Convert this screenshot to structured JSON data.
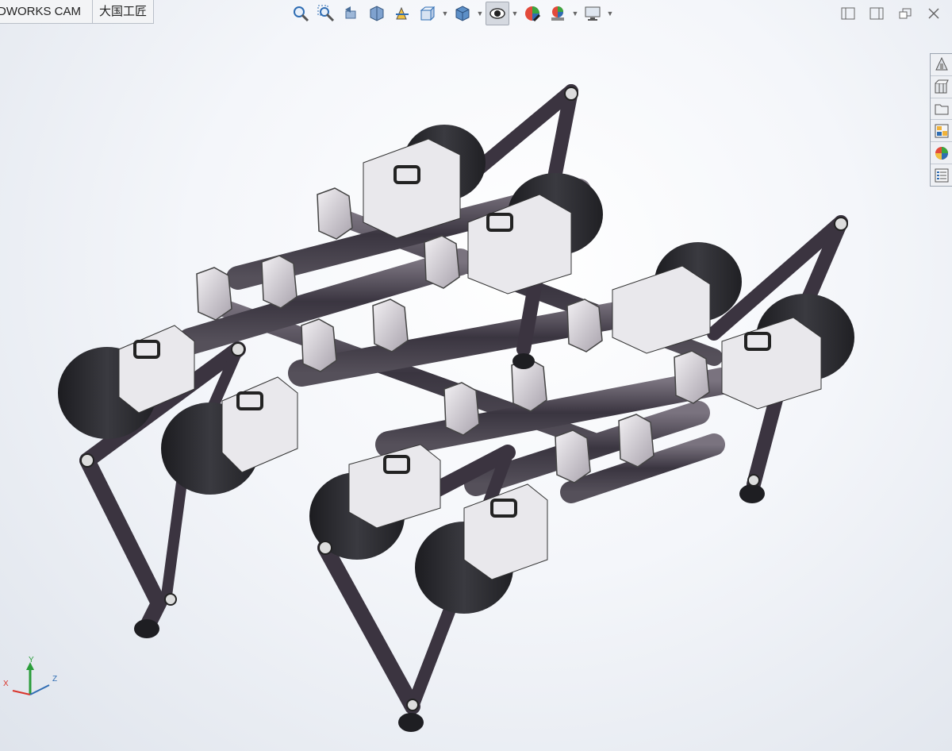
{
  "tabs": [
    {
      "label": "DWORKS CAM"
    },
    {
      "label": "大国工匠"
    }
  ],
  "view_toolbar": {
    "tools": [
      "zoom-to-fit-icon",
      "zoom-to-area-icon",
      "previous-view-icon",
      "section-view-icon",
      "dynamic-annotation-view-icon",
      "view-orientation-icon",
      "display-style-icon",
      "hide-show-items-icon",
      "edit-appearance-icon",
      "apply-scene-icon",
      "view-settings-icon"
    ],
    "active_tool": "hide-show-items-icon"
  },
  "window_controls": [
    "tile-left-icon",
    "tile-right-icon",
    "restore-icon",
    "close-icon"
  ],
  "task_pane": [
    "solidworks-resources-icon",
    "design-library-icon",
    "file-explorer-icon",
    "view-palette-icon",
    "appearances-icon",
    "custom-properties-icon"
  ],
  "triad": {
    "x_label": "X",
    "y_label": "Y",
    "z_label": "Z"
  },
  "colors": {
    "frame": "#3b3440",
    "motor": "#2a2a2e",
    "bracket": "#c9c4cc",
    "tube": "#4a4550"
  }
}
